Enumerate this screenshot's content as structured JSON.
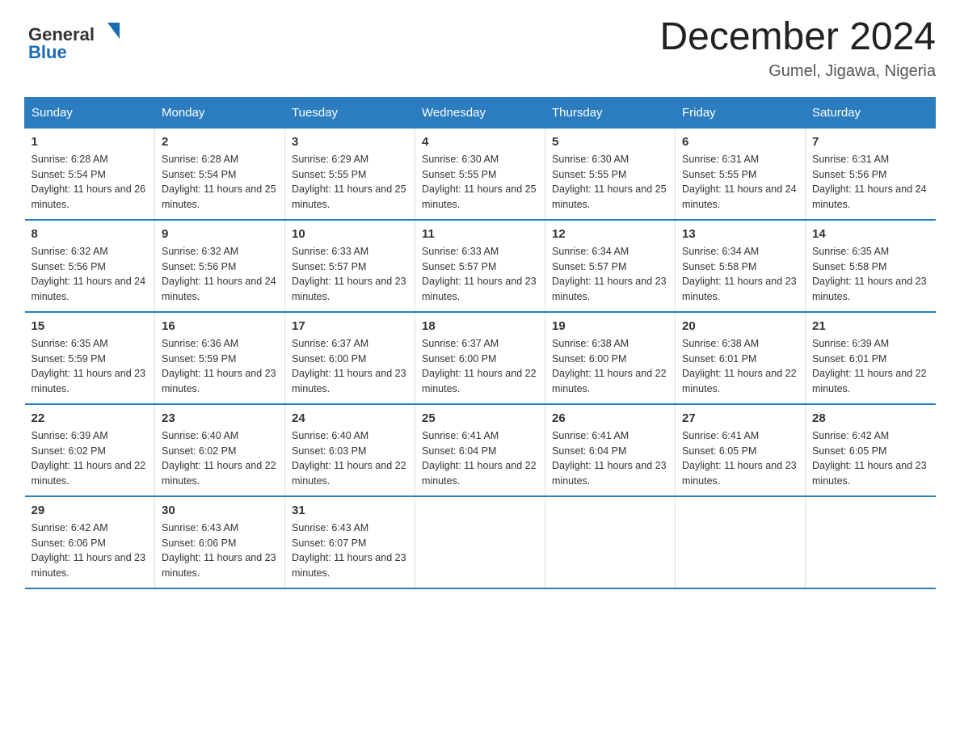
{
  "header": {
    "logo_general": "General",
    "logo_blue": "Blue",
    "title": "December 2024",
    "subtitle": "Gumel, Jigawa, Nigeria"
  },
  "weekdays": [
    "Sunday",
    "Monday",
    "Tuesday",
    "Wednesday",
    "Thursday",
    "Friday",
    "Saturday"
  ],
  "weeks": [
    [
      {
        "day": "1",
        "sunrise": "6:28 AM",
        "sunset": "5:54 PM",
        "daylight": "11 hours and 26 minutes."
      },
      {
        "day": "2",
        "sunrise": "6:28 AM",
        "sunset": "5:54 PM",
        "daylight": "11 hours and 25 minutes."
      },
      {
        "day": "3",
        "sunrise": "6:29 AM",
        "sunset": "5:55 PM",
        "daylight": "11 hours and 25 minutes."
      },
      {
        "day": "4",
        "sunrise": "6:30 AM",
        "sunset": "5:55 PM",
        "daylight": "11 hours and 25 minutes."
      },
      {
        "day": "5",
        "sunrise": "6:30 AM",
        "sunset": "5:55 PM",
        "daylight": "11 hours and 25 minutes."
      },
      {
        "day": "6",
        "sunrise": "6:31 AM",
        "sunset": "5:55 PM",
        "daylight": "11 hours and 24 minutes."
      },
      {
        "day": "7",
        "sunrise": "6:31 AM",
        "sunset": "5:56 PM",
        "daylight": "11 hours and 24 minutes."
      }
    ],
    [
      {
        "day": "8",
        "sunrise": "6:32 AM",
        "sunset": "5:56 PM",
        "daylight": "11 hours and 24 minutes."
      },
      {
        "day": "9",
        "sunrise": "6:32 AM",
        "sunset": "5:56 PM",
        "daylight": "11 hours and 24 minutes."
      },
      {
        "day": "10",
        "sunrise": "6:33 AM",
        "sunset": "5:57 PM",
        "daylight": "11 hours and 23 minutes."
      },
      {
        "day": "11",
        "sunrise": "6:33 AM",
        "sunset": "5:57 PM",
        "daylight": "11 hours and 23 minutes."
      },
      {
        "day": "12",
        "sunrise": "6:34 AM",
        "sunset": "5:57 PM",
        "daylight": "11 hours and 23 minutes."
      },
      {
        "day": "13",
        "sunrise": "6:34 AM",
        "sunset": "5:58 PM",
        "daylight": "11 hours and 23 minutes."
      },
      {
        "day": "14",
        "sunrise": "6:35 AM",
        "sunset": "5:58 PM",
        "daylight": "11 hours and 23 minutes."
      }
    ],
    [
      {
        "day": "15",
        "sunrise": "6:35 AM",
        "sunset": "5:59 PM",
        "daylight": "11 hours and 23 minutes."
      },
      {
        "day": "16",
        "sunrise": "6:36 AM",
        "sunset": "5:59 PM",
        "daylight": "11 hours and 23 minutes."
      },
      {
        "day": "17",
        "sunrise": "6:37 AM",
        "sunset": "6:00 PM",
        "daylight": "11 hours and 23 minutes."
      },
      {
        "day": "18",
        "sunrise": "6:37 AM",
        "sunset": "6:00 PM",
        "daylight": "11 hours and 22 minutes."
      },
      {
        "day": "19",
        "sunrise": "6:38 AM",
        "sunset": "6:00 PM",
        "daylight": "11 hours and 22 minutes."
      },
      {
        "day": "20",
        "sunrise": "6:38 AM",
        "sunset": "6:01 PM",
        "daylight": "11 hours and 22 minutes."
      },
      {
        "day": "21",
        "sunrise": "6:39 AM",
        "sunset": "6:01 PM",
        "daylight": "11 hours and 22 minutes."
      }
    ],
    [
      {
        "day": "22",
        "sunrise": "6:39 AM",
        "sunset": "6:02 PM",
        "daylight": "11 hours and 22 minutes."
      },
      {
        "day": "23",
        "sunrise": "6:40 AM",
        "sunset": "6:02 PM",
        "daylight": "11 hours and 22 minutes."
      },
      {
        "day": "24",
        "sunrise": "6:40 AM",
        "sunset": "6:03 PM",
        "daylight": "11 hours and 22 minutes."
      },
      {
        "day": "25",
        "sunrise": "6:41 AM",
        "sunset": "6:04 PM",
        "daylight": "11 hours and 22 minutes."
      },
      {
        "day": "26",
        "sunrise": "6:41 AM",
        "sunset": "6:04 PM",
        "daylight": "11 hours and 23 minutes."
      },
      {
        "day": "27",
        "sunrise": "6:41 AM",
        "sunset": "6:05 PM",
        "daylight": "11 hours and 23 minutes."
      },
      {
        "day": "28",
        "sunrise": "6:42 AM",
        "sunset": "6:05 PM",
        "daylight": "11 hours and 23 minutes."
      }
    ],
    [
      {
        "day": "29",
        "sunrise": "6:42 AM",
        "sunset": "6:06 PM",
        "daylight": "11 hours and 23 minutes."
      },
      {
        "day": "30",
        "sunrise": "6:43 AM",
        "sunset": "6:06 PM",
        "daylight": "11 hours and 23 minutes."
      },
      {
        "day": "31",
        "sunrise": "6:43 AM",
        "sunset": "6:07 PM",
        "daylight": "11 hours and 23 minutes."
      },
      null,
      null,
      null,
      null
    ]
  ]
}
